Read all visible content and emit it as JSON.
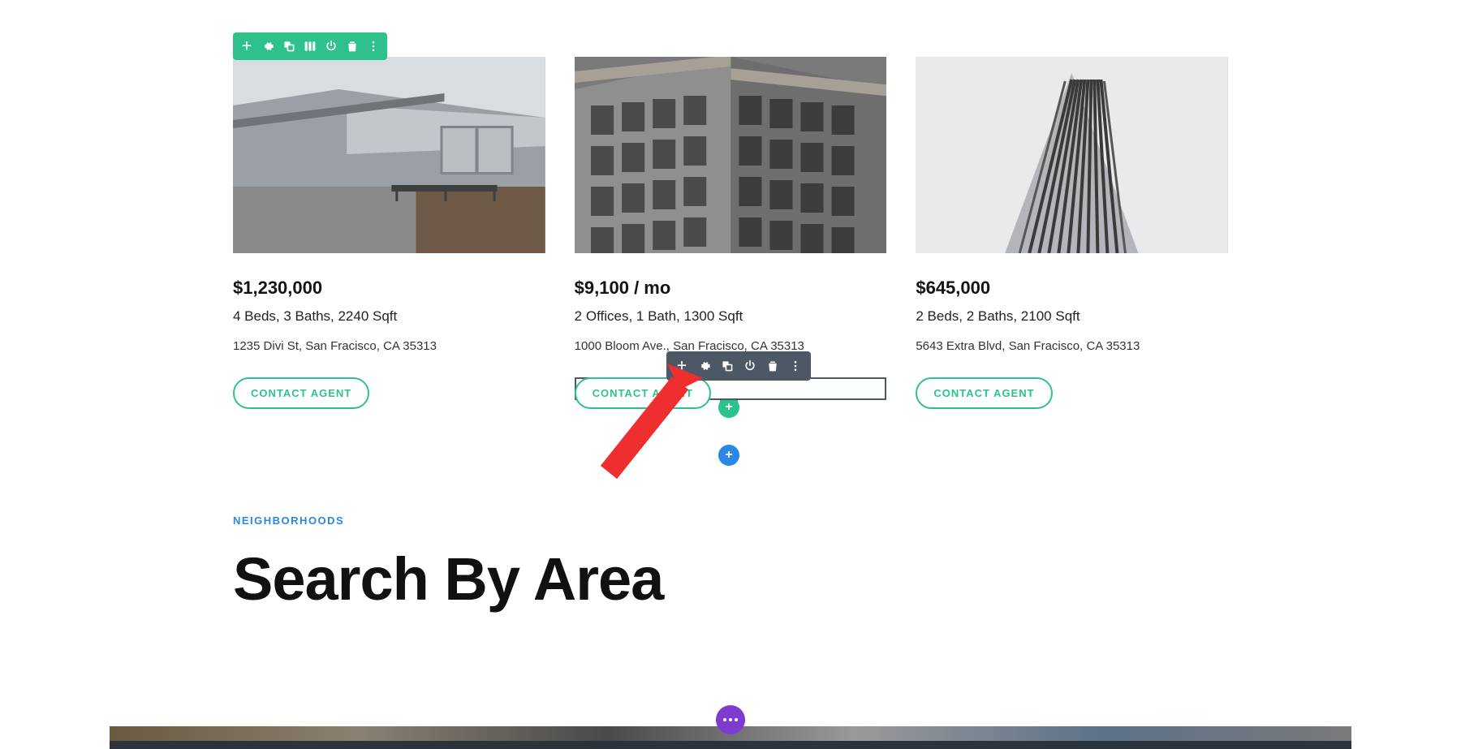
{
  "section_eyebrow": "NEIGHBORHOODS",
  "section_heading": "Search By Area",
  "cards": [
    {
      "price": "$1,230,000",
      "specs": "4 Beds, 3 Baths, 2240 Sqft",
      "address": "1235 Divi St, San Fracisco, CA 35313",
      "cta": "CONTACT AGENT"
    },
    {
      "price": "$9,100 / mo",
      "specs": "2 Offices, 1 Bath, 1300 Sqft",
      "address": "1000 Bloom Ave., San Fracisco, CA 35313",
      "cta": "CONTACT AGENT"
    },
    {
      "price": "$645,000",
      "specs": "2 Beds, 2 Baths, 2100 Sqft",
      "address": "5643 Extra Blvd, San Fracisco, CA 35313",
      "cta": "CONTACT AGENT"
    }
  ],
  "colors": {
    "accent_teal": "#2fc18c",
    "toolbar_dark": "#4c5866",
    "link_blue": "#2b87e3",
    "fab_purple": "#7e3bd0"
  }
}
